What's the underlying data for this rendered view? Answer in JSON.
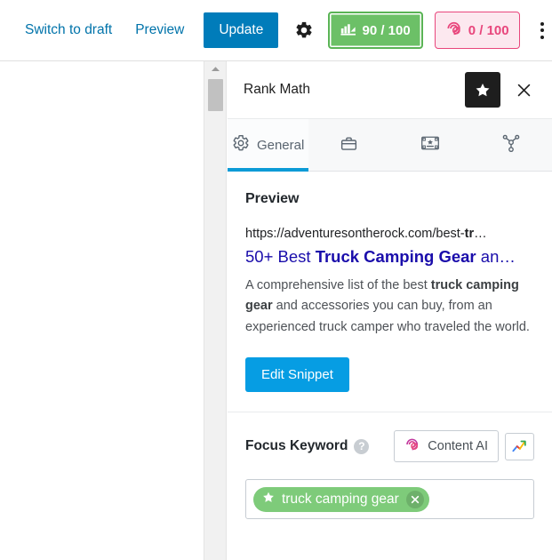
{
  "topbar": {
    "switch_to_draft": "Switch to draft",
    "preview": "Preview",
    "update": "Update",
    "settings_icon": "gear-icon",
    "kebab_icon": "more-options-icon",
    "seo_score": {
      "icon": "seo-score-icon",
      "value": "90 / 100",
      "bg_color": "#6cc067",
      "text_color": "#ffffff"
    },
    "content_ai_score": {
      "icon": "content-ai-icon",
      "value": "0 / 100",
      "bg_color": "#fce8ef",
      "text_color": "#e8467c"
    },
    "update_bg_color": "#007cba",
    "link_color": "#0073aa"
  },
  "scrollbar": {
    "up_arrow_icon": "scroll-up-arrow-icon"
  },
  "panel": {
    "title": "Rank Math",
    "pin_icon": "star-icon",
    "close_icon": "close-icon",
    "tabs": [
      {
        "label": "General",
        "icon": "gear-icon",
        "active": true
      },
      {
        "label": "",
        "icon": "briefcase-icon",
        "active": false
      },
      {
        "label": "",
        "icon": "schema-card-icon",
        "active": false
      },
      {
        "label": "",
        "icon": "social-share-icon",
        "active": false
      }
    ],
    "active_tab_color": "#0c9bd6"
  },
  "preview": {
    "heading": "Preview",
    "url_plain": "https://adventuresontherock.com/best-",
    "url_bold": "tr",
    "url_ellipsis": "…",
    "title_part1": "50+ Best ",
    "title_bold": "Truck Camping Gear",
    "title_part2": " an",
    "title_ellipsis": "…",
    "description_part1": "A comprehensive list of the best ",
    "description_bold": "truck camping gear",
    "description_part2": " and accessories you can buy, from an experienced truck camper who traveled the world.",
    "edit_snippet_button": "Edit Snippet",
    "title_color": "#1a0dab",
    "url_color": "#202124",
    "description_color": "#4d5156"
  },
  "focus_keyword": {
    "label": "Focus Keyword",
    "help_icon": "help-icon",
    "help_glyph": "?",
    "content_ai_button": "Content AI",
    "content_ai_icon": "content-ai-icon",
    "trends_button_icon": "trends-arrow-icon",
    "input_placeholder": "",
    "tags": [
      {
        "label": "truck camping gear",
        "star_icon": "star-icon",
        "remove_icon": "remove-tag-icon",
        "color": "#7ecb7a"
      }
    ]
  }
}
